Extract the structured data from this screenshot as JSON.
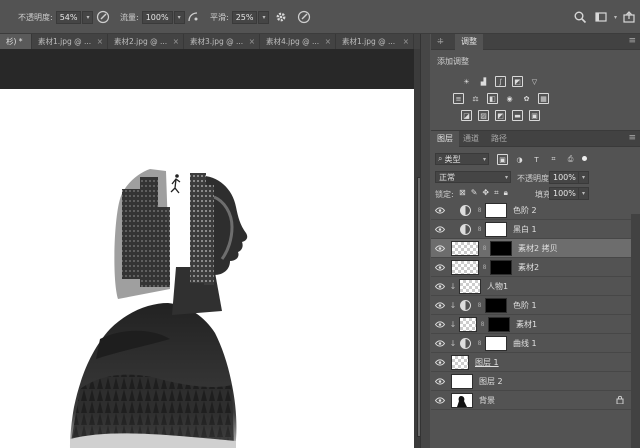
{
  "options_bar": {
    "opacity_label": "不透明度:",
    "opacity_value": "54%",
    "flow_label": "流量:",
    "flow_value": "100%",
    "smooth_label": "平滑:",
    "smooth_value": "25%"
  },
  "doc_tabs": [
    {
      "label": "杉) *",
      "active": true
    },
    {
      "label": "素材1.jpg @ ...",
      "active": false
    },
    {
      "label": "素材2.jpg @ ...",
      "active": false
    },
    {
      "label": "素材3.jpg @ ...",
      "active": false
    },
    {
      "label": "素材4.jpg @ ...",
      "active": false
    },
    {
      "label": "素材1.jpg @ ...",
      "active": false
    }
  ],
  "adjust_panel": {
    "tabs": [
      "调整"
    ],
    "title": "添加调整"
  },
  "layers_panel": {
    "tabs": [
      "图层",
      "通道",
      "路径"
    ],
    "filter_value": "类型",
    "blend_mode": "正常",
    "opacity_label": "不透明度:",
    "opacity_value": "100%",
    "lock_label": "锁定:",
    "fill_label": "填充:",
    "fill_value": "100%",
    "layers": [
      {
        "name": "色阶 2",
        "kind": "adjust",
        "thumb": "white",
        "clip": false,
        "selected": false
      },
      {
        "name": "黑白 1",
        "kind": "adjust",
        "thumb": "white",
        "clip": false,
        "selected": false
      },
      {
        "name": "素材2 拷贝",
        "kind": "image",
        "thumb": "check",
        "mask": "black",
        "clip": false,
        "selected": true
      },
      {
        "name": "素材2",
        "kind": "image",
        "thumb": "check",
        "mask": "black",
        "clip": false,
        "selected": false
      },
      {
        "name": "人物1",
        "kind": "image",
        "thumb": "check",
        "clip": true,
        "selected": false
      },
      {
        "name": "色阶 1",
        "kind": "adjust",
        "thumb": "black",
        "clip": true,
        "selected": false
      },
      {
        "name": "素材1",
        "kind": "image",
        "thumb": "check",
        "mask": "black",
        "clip": true,
        "selected": false
      },
      {
        "name": "曲线 1",
        "kind": "adjust",
        "thumb": "white",
        "clip": true,
        "selected": false
      },
      {
        "name": "图层 1",
        "kind": "image",
        "thumb": "check",
        "clip": false,
        "selected": false
      },
      {
        "name": "图层 2",
        "kind": "image",
        "thumb": "white",
        "clip": false,
        "selected": false
      },
      {
        "name": "背景",
        "kind": "image",
        "thumb": "bg",
        "clip": false,
        "locked": true,
        "selected": false
      }
    ]
  }
}
